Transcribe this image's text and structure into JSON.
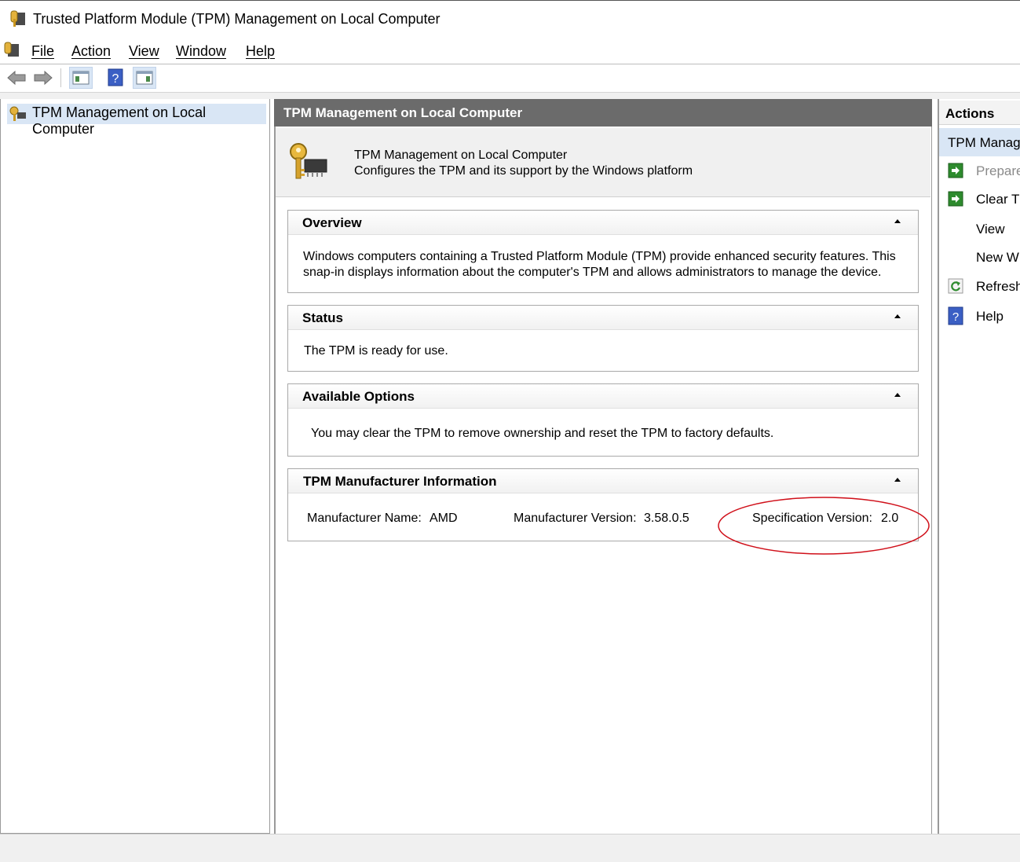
{
  "window": {
    "title": "Trusted Platform Module (TPM) Management on Local Computer"
  },
  "menu": {
    "file": "File",
    "action": "Action",
    "view": "View",
    "window": "Window",
    "help": "Help"
  },
  "tree": {
    "root": "TPM Management on Local Computer"
  },
  "main": {
    "header": "TPM Management on Local Computer",
    "desc_title": "TPM Management on Local Computer",
    "desc_text": "Configures the TPM and its support by the Windows platform",
    "sections": {
      "overview": {
        "title": "Overview",
        "line1": "Windows computers containing a Trusted Platform Module (TPM) provide enhanced security features. This",
        "line2": "snap-in displays information about the computer's TPM and allows administrators to manage the device."
      },
      "status": {
        "title": "Status",
        "text": "The TPM is ready for use."
      },
      "options": {
        "title": "Available Options",
        "text": "You may clear the TPM to remove ownership and reset the TPM to factory defaults."
      },
      "manufacturer": {
        "title": "TPM Manufacturer Information",
        "name_label": "Manufacturer Name:",
        "name_value": "AMD",
        "version_label": "Manufacturer Version:",
        "version_value": "3.58.0.5",
        "spec_label": "Specification Version:",
        "spec_value": "2.0"
      }
    }
  },
  "actions": {
    "header": "Actions",
    "subheader": "TPM Manag",
    "items": [
      "Prepare",
      "Clear TI",
      "View",
      "New W",
      "Refresh",
      "Help"
    ]
  },
  "colors": {
    "highlight": "#d9e6f5",
    "header_bg": "#6b6b6b",
    "annotation": "#d0101a"
  }
}
